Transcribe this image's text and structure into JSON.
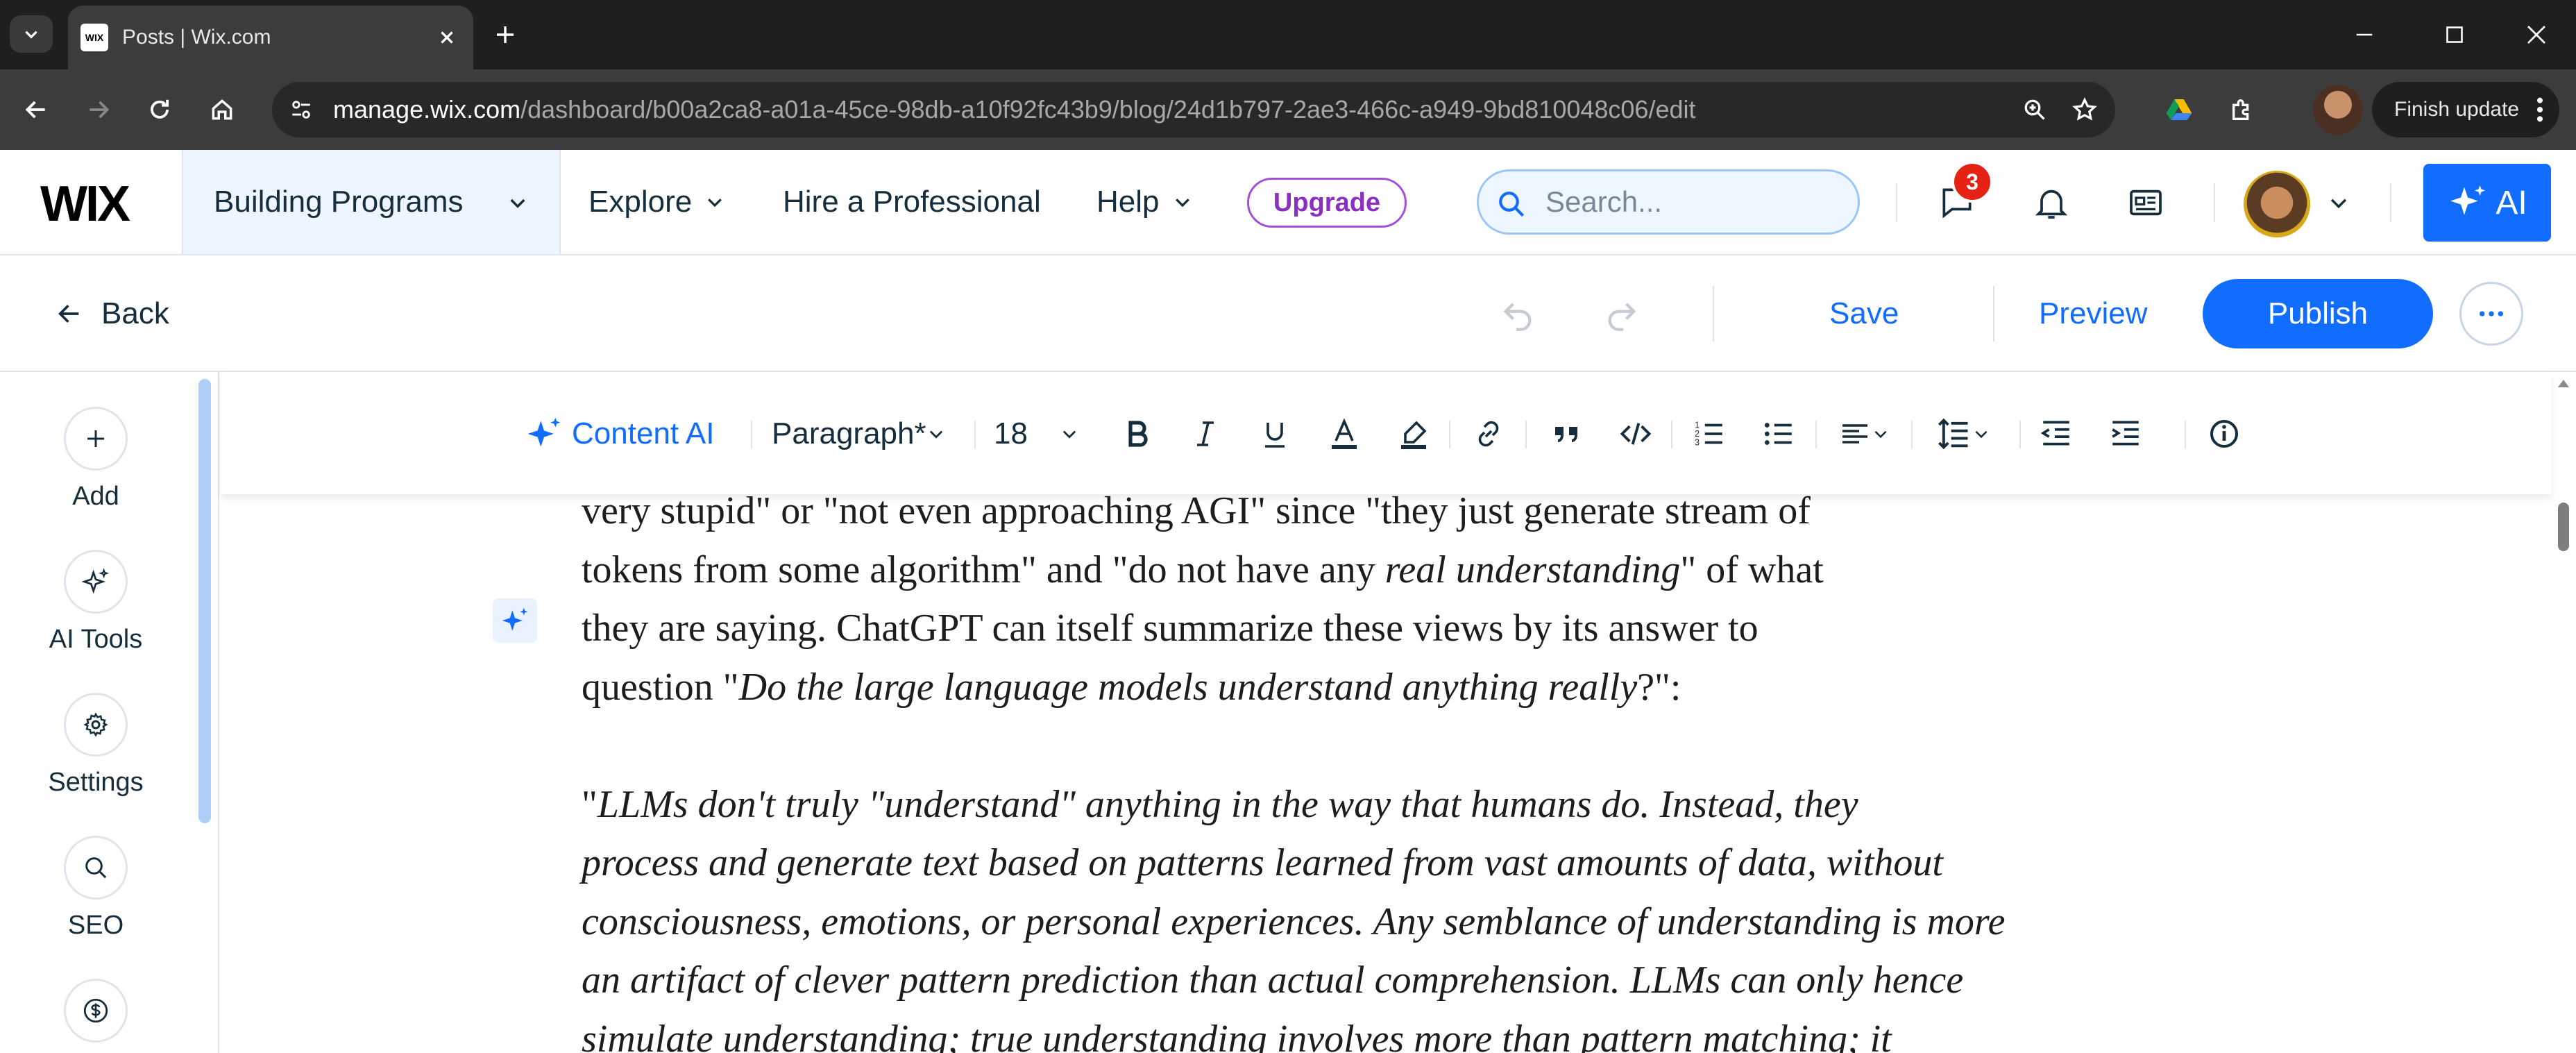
{
  "browser": {
    "tab_title": "Posts | Wix.com",
    "tab_favicon_text": "WIX",
    "url_domain": "manage.wix.com",
    "url_path": "/dashboard/b00a2ca8-a01a-45ce-98db-a10f92fc43b9/blog/24d1b797-2ae3-466c-a949-9bd810048c06/edit",
    "finish_update_label": "Finish update"
  },
  "wix_header": {
    "logo": "WIX",
    "site_name": "Building Programs",
    "nav": [
      "Explore",
      "Hire a Professional",
      "Help"
    ],
    "upgrade_label": "Upgrade",
    "search_placeholder": "Search...",
    "notification_count": "3",
    "ai_label": "AI"
  },
  "editor_bar": {
    "back_label": "Back",
    "save_label": "Save",
    "preview_label": "Preview",
    "publish_label": "Publish"
  },
  "sidebar": {
    "items": [
      {
        "label": "Add",
        "icon": "plus-icon"
      },
      {
        "label": "AI Tools",
        "icon": "sparkle-icon"
      },
      {
        "label": "Settings",
        "icon": "gear-icon"
      },
      {
        "label": "SEO",
        "icon": "search-icon"
      },
      {
        "label": "",
        "icon": "dollar-icon"
      }
    ]
  },
  "format_toolbar": {
    "content_ai_label": "Content AI",
    "paragraph_style": "Paragraph*",
    "font_size": "18"
  },
  "document": {
    "para1_line1": "very stupid\" or \"not even approaching AGI\" since \"they just generate stream of",
    "para1_line2_a": "tokens from some algorithm\" and \"do not have any ",
    "para1_line2_em": "real understanding",
    "para1_line2_b": "\" of what",
    "para1_line3": "they are saying. ChatGPT can itself summarize these views by its answer to",
    "para1_line4_a": "question \"",
    "para1_line4_em": "Do the large language models understand anything really",
    "para1_line4_b": "?\":",
    "quote_open": "\"",
    "quote_line1": "LLMs don't truly \"understand\" anything in the way that humans do. Instead, they",
    "quote_line2": "process and generate text based on patterns learned from vast amounts of data, without",
    "quote_line3": "consciousness, emotions, or personal experiences. Any semblance of understanding is more",
    "quote_line4": "an artifact of clever pattern prediction than actual comprehension. LLMs can only hence",
    "quote_line5": "simulate understanding; true understanding involves more than pattern matching; it"
  },
  "colors": {
    "accent": "#116dff",
    "upgrade": "#a34fd8",
    "badge": "#e62214"
  }
}
